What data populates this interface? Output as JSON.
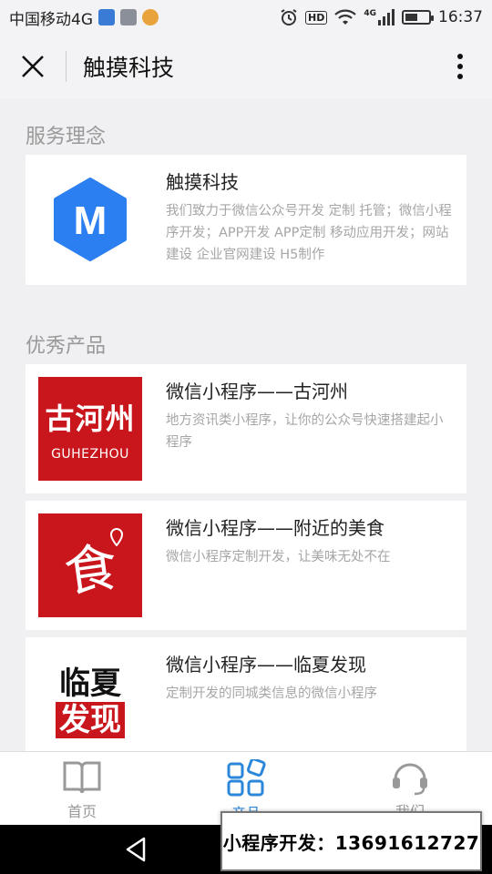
{
  "status_bar": {
    "carrier": "中国移动4G",
    "network_small": "4G",
    "hd_badge": "HD",
    "time": "16:37",
    "battery_level": 0.55
  },
  "navbar": {
    "title": "触摸科技"
  },
  "sections": {
    "service": {
      "title": "服务理念",
      "card": {
        "logo_letter": "M",
        "title": "触摸科技",
        "desc": "我们致力于微信公众号开发 定制 托管；微信小程序开发；APP开发 APP定制 移动应用开发；网站建设 企业官网建设 H5制作"
      }
    },
    "products": {
      "title": "优秀产品",
      "items": [
        {
          "title": "微信小程序——古河州",
          "desc": "地方资讯类小程序，让你的公众号快速搭建起小程序",
          "logo_main": "古河州",
          "logo_sub": "GUHEZHOU"
        },
        {
          "title": "微信小程序——附近的美食",
          "desc": "微信小程序定制开发，让美味无处不在",
          "logo_glyph": "食"
        },
        {
          "title": "微信小程序——临夏发现",
          "desc": "定制开发的同城类信息的微信小程序",
          "logo_line1": "临夏",
          "logo_line2": "发现"
        }
      ]
    }
  },
  "tabbar": {
    "items": [
      {
        "label": "首页",
        "icon": "book-icon"
      },
      {
        "label": "产品",
        "icon": "apps-icon"
      },
      {
        "label": "我们",
        "icon": "headset-icon"
      }
    ],
    "active_index": 1
  },
  "promo": {
    "text": "小程序开发：13691612727"
  },
  "colors": {
    "accent": "#2b87da",
    "logo_blue": "#2b7ff0",
    "product_red": "#c9161d"
  }
}
